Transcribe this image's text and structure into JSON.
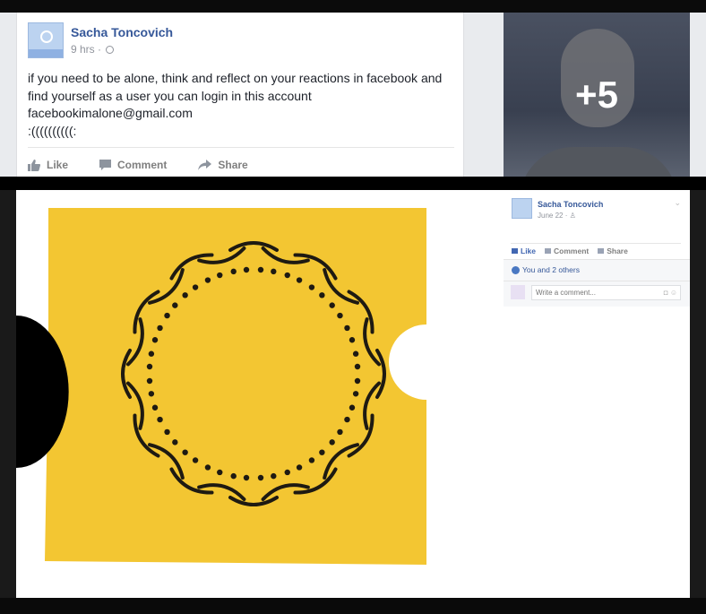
{
  "post": {
    "author": "Sacha Toncovich",
    "time": "9 hrs",
    "separator": "·",
    "lines": [
      "if you need to be alone, think and reflect on your reactions in facebook and",
      "find yourself as a user you can login in this account",
      "facebookimalone@gmail.com",
      ":((((((((((:"
    ],
    "actions": {
      "like": "Like",
      "comment": "Comment",
      "share": "Share"
    },
    "more_photos": "+5"
  },
  "viewer": {
    "author": "Sacha Toncovich",
    "date": "June 22",
    "separator": "·",
    "actions": {
      "like": "Like",
      "comment": "Comment",
      "share": "Share"
    },
    "likes": "You and 2 others",
    "comment_placeholder": "Write a comment..."
  },
  "colors": {
    "link_blue": "#365899",
    "photo_yellow": "#f3c632",
    "smiley_ink": "#1e1a12"
  }
}
